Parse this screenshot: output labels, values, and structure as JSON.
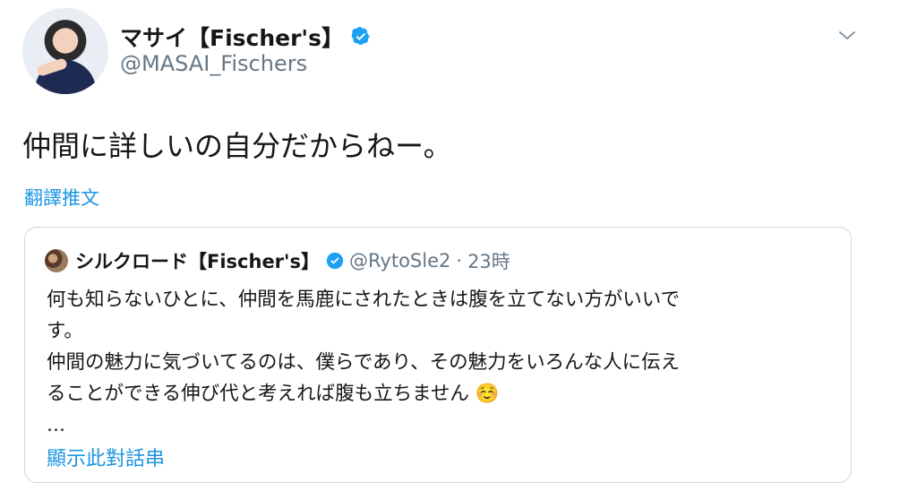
{
  "author": {
    "display_name": "マサイ【Fischer's】",
    "handle": "@MASAI_Fischers"
  },
  "tweet": {
    "text": "仲間に詳しいの自分だからねー。",
    "translate_label": "翻譯推文"
  },
  "quoted_tweet": {
    "display_name": "シルクロード【Fischer's】",
    "handle": "@RytoSle2",
    "separator": "·",
    "time": "23時",
    "lines": [
      "何も知らないひとに、仲間を馬鹿にされたときは腹を立てない方がいいで",
      "す。",
      "仲間の魅力に気づいてるのは、僕らであり、その魅力をいろんな人に伝え",
      "ることができる伸び代と考えれば腹も立ちません ☺️"
    ],
    "ellipsis": "…",
    "show_thread_label": "顯示此對話串"
  },
  "colors": {
    "link": "#1b95e0",
    "secondary_text": "#657786",
    "verified": "#1da1f2",
    "border": "#ccd6dd"
  },
  "icons": {
    "verified": "verified-badge-icon",
    "menu": "chevron-down-icon"
  }
}
